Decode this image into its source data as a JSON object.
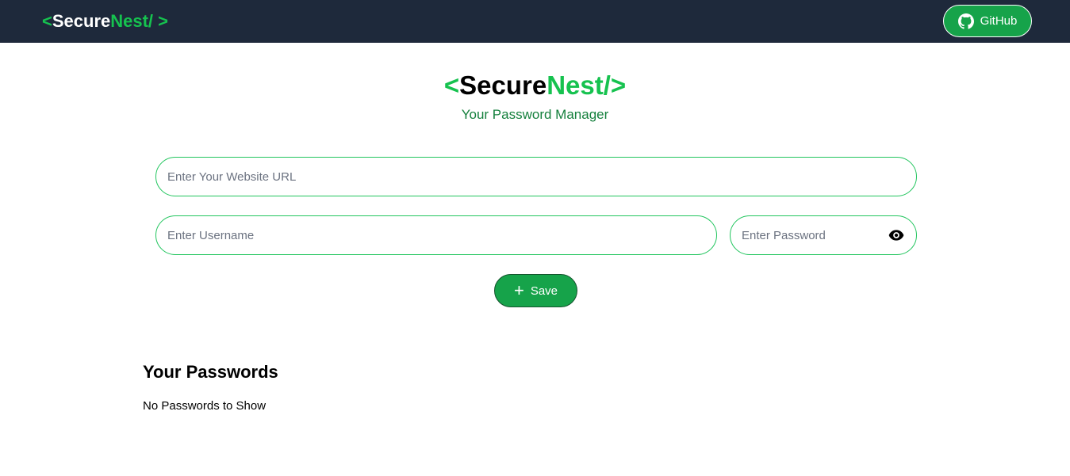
{
  "navbar": {
    "logo": {
      "open": "<",
      "secure": "Secure",
      "nest": "Nest/",
      "close": " >"
    },
    "github_label": "GitHub"
  },
  "hero": {
    "logo": {
      "open": "<",
      "secure": "Secure",
      "nest": "Nest/",
      "close": ">"
    },
    "subtitle": "Your Password Manager"
  },
  "form": {
    "url_placeholder": "Enter Your Website URL",
    "url_value": "",
    "username_placeholder": "Enter Username",
    "username_value": "",
    "password_placeholder": "Enter Password",
    "password_value": "",
    "save_label": "Save",
    "icons": {
      "save": "plus-icon",
      "toggle_password": "eye-icon"
    }
  },
  "passwords": {
    "title": "Your Passwords",
    "empty_message": "No Passwords to Show"
  },
  "colors": {
    "navbar_bg": "#1e293b",
    "accent_green": "#16c24f",
    "button_green": "#16a34a",
    "input_border": "#22c55e"
  }
}
